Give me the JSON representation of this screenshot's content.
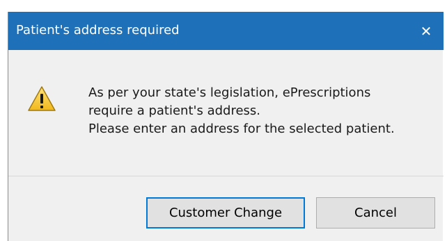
{
  "dialog": {
    "title": "Patient's address required",
    "close_glyph": "✕",
    "icon": "warning-icon",
    "message_lines": [
      "As per your state's legislation, ePrescriptions",
      "require a patient's address.",
      "Please enter an address for the selected patient."
    ],
    "buttons": {
      "customer_change": "Customer Change",
      "cancel": "Cancel"
    }
  },
  "colors": {
    "titlebar": "#1e71b8",
    "body": "#f0f0f0",
    "primary_border": "#0078d7"
  }
}
